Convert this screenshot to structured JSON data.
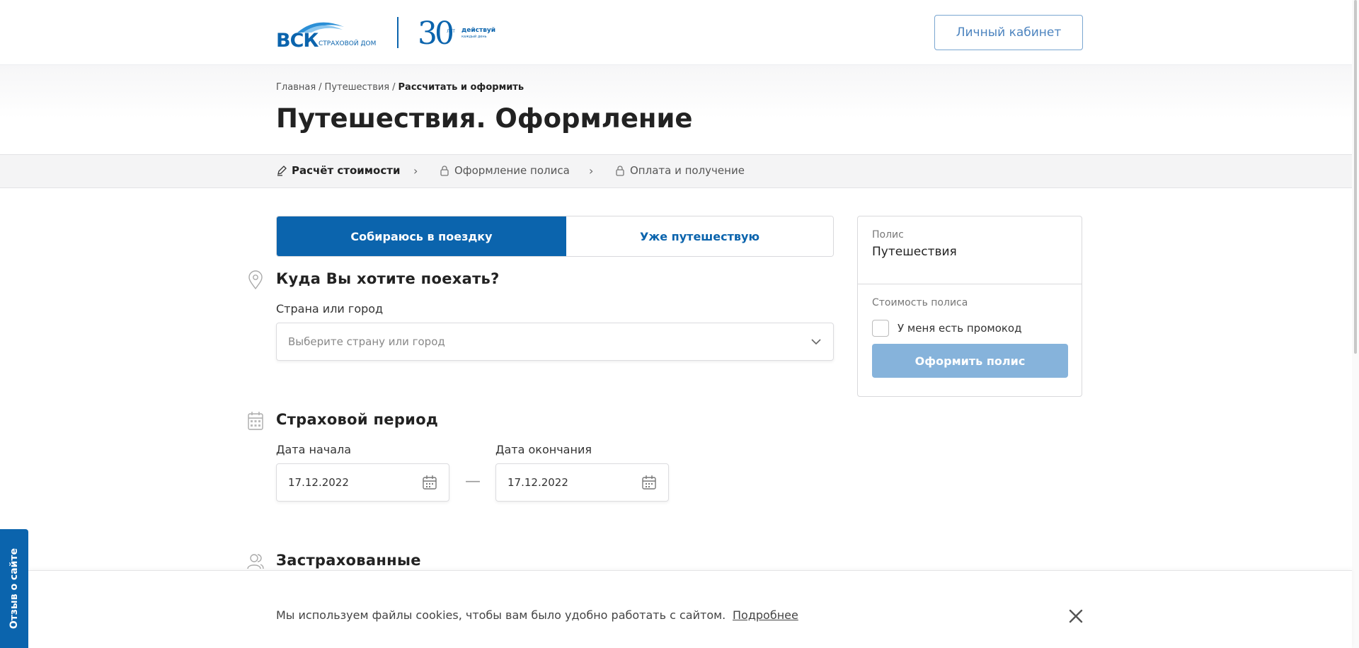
{
  "header": {
    "logo_text": "ВСК",
    "logo_sub": "СТРАХОВОЙ ДОМ",
    "logo_anniversary": "30",
    "logo_years": "ЛЕТ",
    "logo_tagline": "действуй",
    "logo_tagline_sub": "каждый день",
    "cabinet_label": "Личный кабинет"
  },
  "breadcrumb": {
    "items": [
      "Главная",
      "Путешествия"
    ],
    "separator": "/",
    "current": "Рассчитать и оформить"
  },
  "page_title": "Путешествия. Оформление",
  "steps": [
    {
      "label": "Расчёт стоимости",
      "icon": "pencil-icon",
      "active": true
    },
    {
      "label": "Оформление полиса",
      "icon": "lock-icon",
      "active": false
    },
    {
      "label": "Оплата и получение",
      "icon": "lock-icon",
      "active": false
    }
  ],
  "step_chevron": "›",
  "trip_tabs": [
    {
      "label": "Собираюсь в поездку",
      "active": true
    },
    {
      "label": "Уже путешествую",
      "active": false
    }
  ],
  "destination": {
    "title": "Куда Вы хотите поехать?",
    "field_label": "Страна или город",
    "placeholder": "Выберите страну или город"
  },
  "period": {
    "title": "Страховой период",
    "start_label": "Дата начала",
    "start_value": "17.12.2022",
    "end_label": "Дата окончания",
    "end_value": "17.12.2022",
    "separator": "—"
  },
  "insured": {
    "title": "Застрахованные"
  },
  "side_card": {
    "policy_label": "Полис",
    "policy_value": "Путешествия",
    "cost_label": "Стоимость полиса",
    "promo_label": "У меня есть промокод",
    "promo_checked": false,
    "submit_label": "Оформить полис"
  },
  "feedback_label": "Отзыв о сайте",
  "cookie": {
    "text": "Мы используем файлы cookies, чтобы вам было удобно работать с сайтом.",
    "link": "Подробнее"
  },
  "colors": {
    "brand": "#0b64ad",
    "button_disabled": "#86b3db"
  }
}
